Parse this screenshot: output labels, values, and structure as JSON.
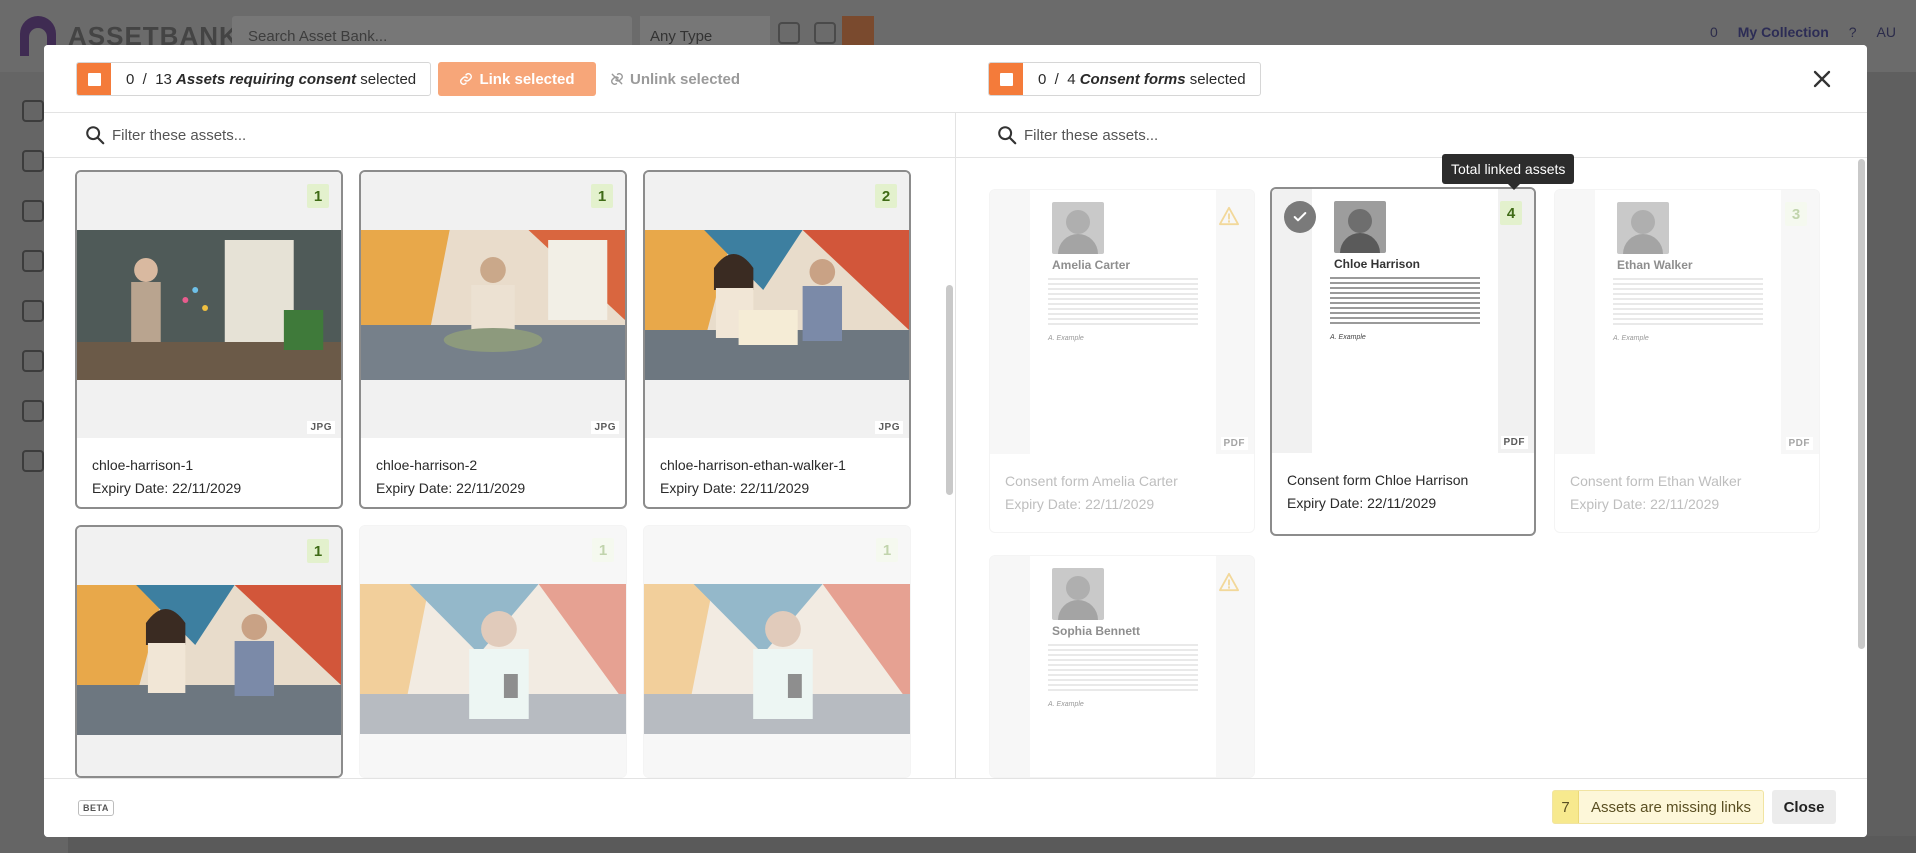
{
  "app": {
    "logo_text": "ASSETBANK",
    "search_placeholder": "Search Asset Bank...",
    "type_filter": "Any Type",
    "collection_count": "0",
    "collection_label": "My Collection",
    "help": "?",
    "user_initials": "AU"
  },
  "modal": {
    "assets_selected": "0",
    "assets_total": "13",
    "assets_label": "Assets requiring consent",
    "selected_word": "selected",
    "link_label": "Link selected",
    "unlink_label": "Unlink selected",
    "consent_selected": "0",
    "consent_total": "4",
    "consent_label": "Consent forms",
    "left_filter_placeholder": "Filter these assets...",
    "right_filter_placeholder": "Filter these assets...",
    "tooltip": "Total linked assets"
  },
  "assets": [
    {
      "name": "chloe-harrison-1",
      "expiry": "Expiry Date: 22/11/2029",
      "count": "1",
      "type": "JPG"
    },
    {
      "name": "chloe-harrison-2",
      "expiry": "Expiry Date: 22/11/2029",
      "count": "1",
      "type": "JPG"
    },
    {
      "name": "chloe-harrison-ethan-walker-1",
      "expiry": "Expiry Date: 22/11/2029",
      "count": "2",
      "type": "JPG"
    },
    {
      "name": "",
      "expiry": "",
      "count": "1",
      "type": ""
    },
    {
      "name": "",
      "expiry": "",
      "count": "1",
      "type": ""
    },
    {
      "name": "",
      "expiry": "",
      "count": "1",
      "type": ""
    }
  ],
  "consent_forms": [
    {
      "title": "Consent form Amelia Carter",
      "doc_name": "Amelia Carter",
      "expiry": "Expiry Date: 22/11/2029",
      "type": "PDF",
      "count": "",
      "signature": "A. Example"
    },
    {
      "title": "Consent form Chloe Harrison",
      "doc_name": "Chloe Harrison",
      "expiry": "Expiry Date: 22/11/2029",
      "type": "PDF",
      "count": "4",
      "signature": "A. Example"
    },
    {
      "title": "Consent form Ethan Walker",
      "doc_name": "Ethan Walker",
      "expiry": "Expiry Date: 22/11/2029",
      "type": "PDF",
      "count": "3",
      "signature": "A. Example"
    },
    {
      "title": "",
      "doc_name": "Sophia Bennett",
      "expiry": "",
      "type": "",
      "count": "",
      "signature": "A. Example"
    }
  ],
  "footer": {
    "beta": "BETA",
    "missing_count": "7",
    "missing_label": "Assets are missing links",
    "close_label": "Close"
  },
  "colors": {
    "accent": "#f47b3a",
    "badge_bg": "#e3f1cd",
    "warning": "#e9b949"
  }
}
